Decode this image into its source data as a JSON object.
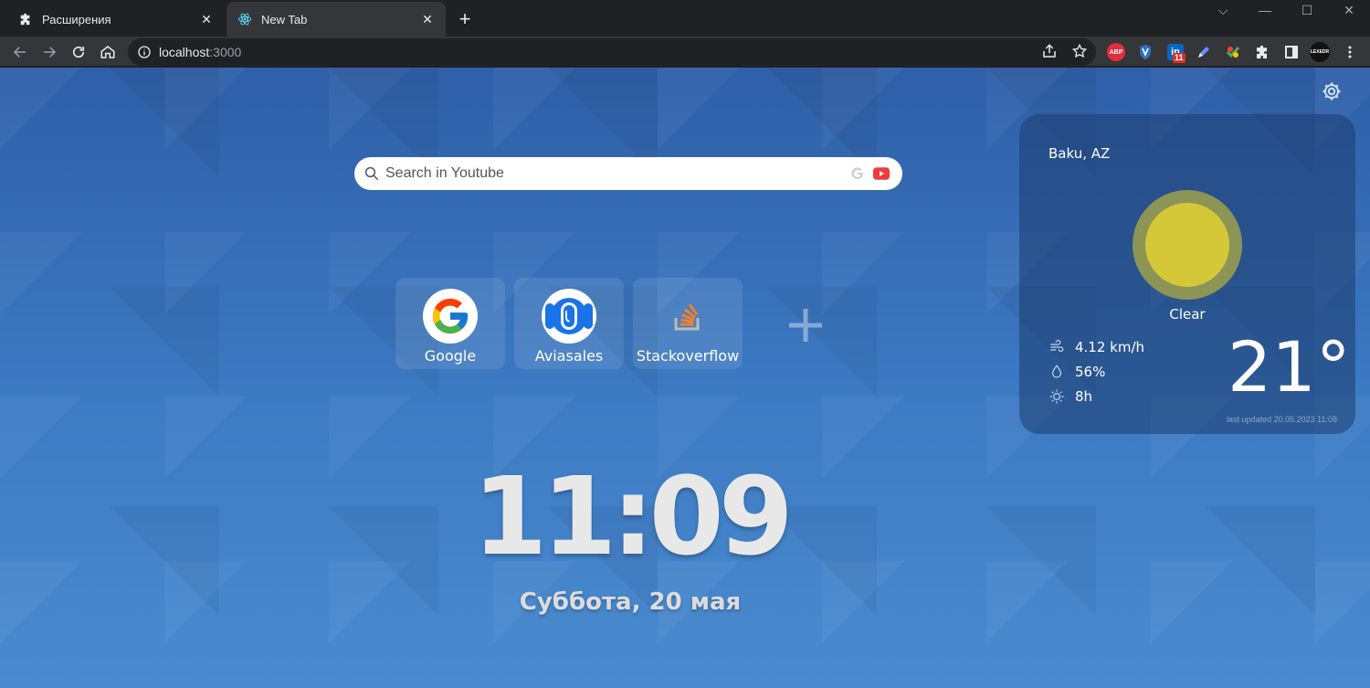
{
  "browser": {
    "tabs": [
      {
        "title": "Расширения",
        "icon": "puzzle-icon"
      },
      {
        "title": "New Tab",
        "icon": "react-icon"
      }
    ],
    "window_controls": {
      "dropdown": "⌵",
      "minimize": "—",
      "maximize": "☐",
      "close": "✕"
    },
    "url": {
      "host": "localhost",
      "port": ":3000"
    },
    "extensions": [
      {
        "name": "adblock-plus-icon",
        "label": "ABP",
        "color": "#e12c3a"
      },
      {
        "name": "shield-extension-icon",
        "label": "",
        "color": "#4aa3ff"
      },
      {
        "name": "linkedin-extension-icon",
        "label": "in",
        "badge": "11",
        "color": "#0a66c2"
      },
      {
        "name": "pen-extension-icon",
        "label": "",
        "color": "#6b8cff"
      },
      {
        "name": "colorful-extension-icon",
        "label": "",
        "color": "#f44336"
      },
      {
        "name": "puzzle-extensions-icon",
        "label": "",
        "color": "#ffffff"
      },
      {
        "name": "side-panel-icon",
        "label": "",
        "color": "#ffffff"
      },
      {
        "name": "lexedr-extension-icon",
        "label": "LEXEDR",
        "color": "#e12c3a"
      },
      {
        "name": "menu-dots-icon",
        "label": "",
        "color": "#ffffff"
      }
    ]
  },
  "page": {
    "search": {
      "placeholder": "Search in Youtube"
    },
    "shortcuts": [
      {
        "label": "Google",
        "icon": "google-logo-icon"
      },
      {
        "label": "Aviasales",
        "icon": "aviasales-logo-icon"
      },
      {
        "label": "Stackoverflow",
        "icon": "stackoverflow-logo-icon"
      }
    ],
    "clock": {
      "time": "11:09",
      "date": "Суббота, 20 мая"
    },
    "weather": {
      "city": "Baku, AZ",
      "condition": "Clear",
      "wind": "4.12 km/h",
      "humidity": "56%",
      "daylight": "8h",
      "temperature": "21°",
      "updated": "last updated 20.05.2023 11:08",
      "sun_color": "#d4c838"
    }
  }
}
